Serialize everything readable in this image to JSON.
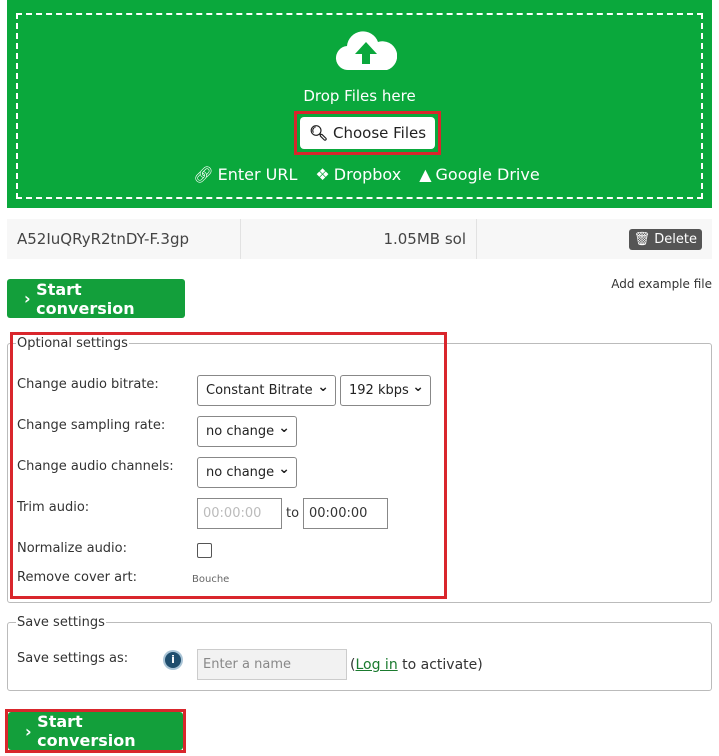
{
  "upload": {
    "drop_text": "Drop Files here",
    "choose_files": "Choose Files",
    "sources": [
      "Enter URL",
      "Dropbox",
      "Google Drive"
    ]
  },
  "file": {
    "name": "A52IuQRyR2tnDY-F.3gp",
    "size": "1.05MB sol",
    "delete": "Delete"
  },
  "start_label": "Start conversion",
  "add_example": "Add example file",
  "optional": {
    "legend": "Optional settings",
    "bitrate_label": "Change audio bitrate:",
    "bitrate_mode": "Constant Bitrate",
    "bitrate_value": "192 kbps",
    "sampling_label": "Change sampling rate:",
    "sampling_value": "no change",
    "channels_label": "Change audio channels:",
    "channels_value": "no change",
    "trim_label": "Trim audio:",
    "trim_from_placeholder": "00:00:00",
    "trim_to": "to",
    "trim_to_value": "00:00:00",
    "normalize_label": "Normalize audio:",
    "cover_label": "Remove cover art:",
    "cover_value": "Bouche"
  },
  "save": {
    "legend": "Save settings",
    "label": "Save settings as:",
    "placeholder": "Enter a name",
    "login_open": "(",
    "login": "Log in",
    "login_rest": " to activate)"
  },
  "colors": {
    "green": "#0aa83c",
    "button_green": "#139f3b",
    "highlight": "#d9262c"
  }
}
